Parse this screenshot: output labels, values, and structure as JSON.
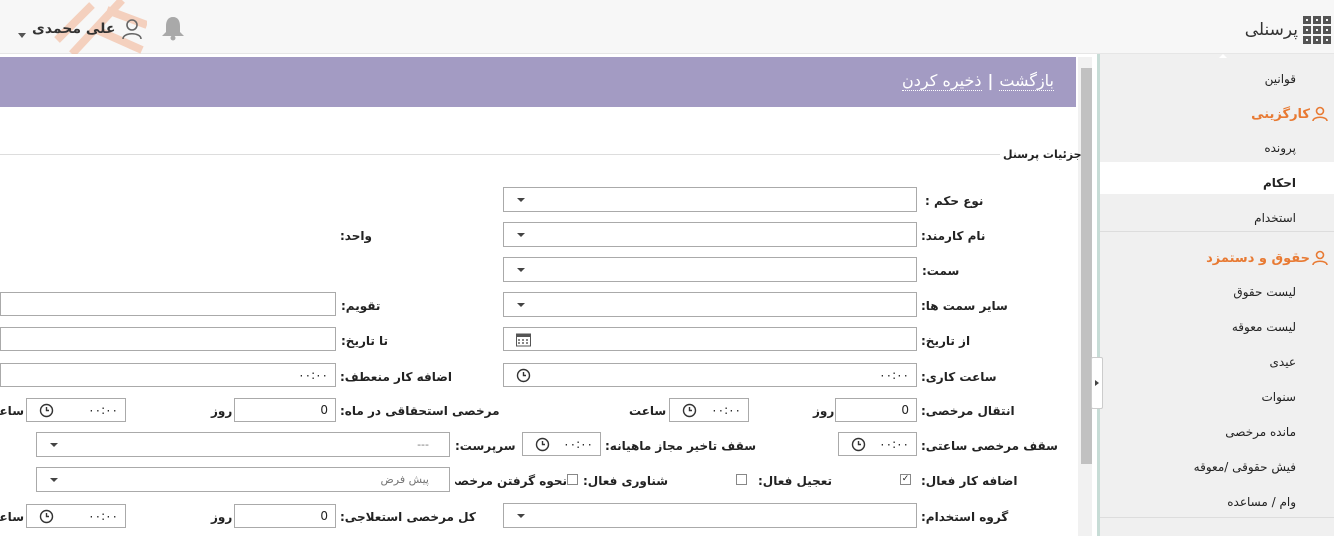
{
  "topbar": {
    "user_name": "علی محمدی",
    "app_title": "پرسنلی",
    "icons": [
      "chevron-down-icon",
      "user-icon",
      "bell-icon",
      "grid-icon"
    ]
  },
  "header": {
    "back_label": "بازگشت",
    "separator": "|",
    "save_label": "ذخیره کردن"
  },
  "section": {
    "title": "جزئیات پرسنل"
  },
  "sidebar": {
    "item_rules": "قوانین",
    "group_hr": "کارگزینی",
    "item_file": "پرونده",
    "item_decrees": "احکام",
    "item_hiring": "استخدام",
    "group_payroll": "حقوق و دستمزد",
    "item_salary_list": "لیست حقوق",
    "item_arrears_list": "لیست معوقه",
    "item_bonus": "عیدی",
    "item_years": "سنوات",
    "item_leave_balance": "مانده مرخصی",
    "item_payslip": "فیش حقوقی /معوقه",
    "item_loan": "وام / مساعده"
  },
  "form": {
    "decree_type": "نوع حکم :",
    "employee_name": "نام کارمند:",
    "unit": "واحد:",
    "position": "سمت:",
    "other_positions": "سایر سمت ها:",
    "calendar": "تقویم:",
    "from_date": "از تاریخ:",
    "to_date": "تا تاریخ:",
    "work_hours": "ساعت کاری:",
    "work_hours_value": "۰۰:۰۰",
    "flex_overtime": "اضافه کار منعطف:",
    "flex_overtime_value": "۰۰:۰۰",
    "leave_transfer": "انتقال مرخصی:",
    "leave_transfer_days": "0",
    "day_unit": "روز",
    "hour_unit": "ساعت",
    "leave_transfer_hours": "۰۰:۰۰",
    "monthly_leave": "مرخصی استحقاقی در ماه:",
    "monthly_leave_days": "0",
    "monthly_leave_hours": "۰۰:۰۰",
    "hourly_leave_cap": "سقف مرخصی ساعتی:",
    "hourly_leave_cap_value": "۰۰:۰۰",
    "monthly_delay_cap": "سقف تاخیر مجاز ماهیانه:",
    "monthly_delay_cap_value": "۰۰:۰۰",
    "supervisor": "سرپرست:",
    "supervisor_value": "---",
    "overtime_active": "اضافه کار فعال:",
    "rush_active": "تعجیل فعال:",
    "floating_active": "شناوری فعال:",
    "leave_method": "نحوه گرفتن مرخصی :",
    "leave_method_value": "پیش فرض",
    "hiring_group": "گروه استخدام:",
    "total_emergency_leave": "کل مرخصی استعلاجی:",
    "total_emergency_leave_days": "0",
    "total_emergency_leave_hours": "۰۰:۰۰"
  }
}
